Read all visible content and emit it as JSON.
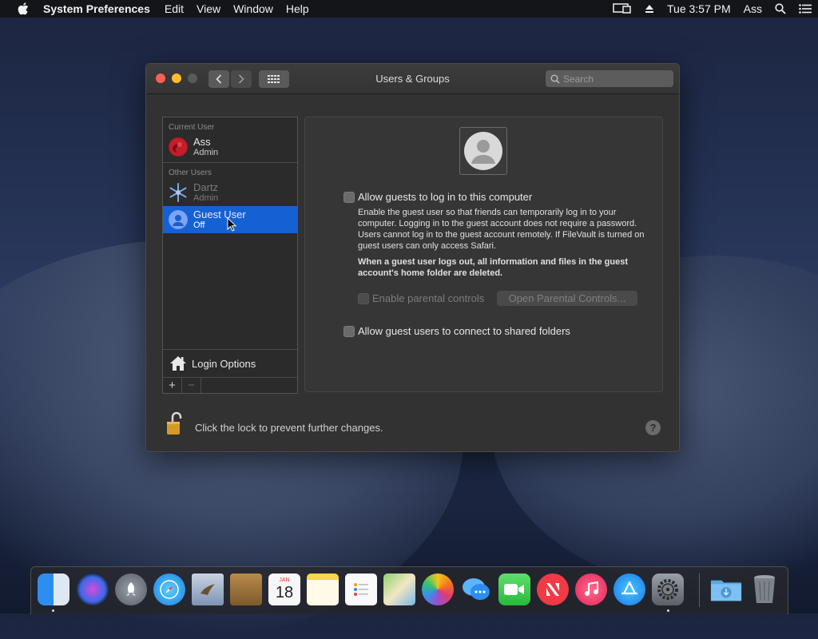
{
  "menubar": {
    "app_name": "System Preferences",
    "menus": [
      "Edit",
      "View",
      "Window",
      "Help"
    ],
    "clock": "Tue 3:57 PM",
    "user": "Ass"
  },
  "window": {
    "title": "Users & Groups",
    "search_placeholder": "Search"
  },
  "sidebar": {
    "current_user_header": "Current User",
    "current_user": {
      "name": "Ass",
      "role": "Admin"
    },
    "other_users_header": "Other Users",
    "other_users": [
      {
        "name": "Dartz",
        "role": "Admin"
      },
      {
        "name": "Guest User",
        "role": "Off"
      }
    ],
    "login_options": "Login Options",
    "add": "+",
    "remove": "−"
  },
  "panel": {
    "allow_guests_label": "Allow guests to log in to this computer",
    "description": "Enable the guest user so that friends can temporarily log in to your computer. Logging in to the guest account does not require a password. Users cannot log in to the guest account remotely. If FileVault is turned on guest users can only access Safari.",
    "warning": "When a guest user logs out, all information and files in the guest account's home folder are deleted.",
    "parental_label": "Enable parental controls",
    "parental_button": "Open Parental Controls...",
    "shared_folders_label": "Allow guest users to connect to shared folders"
  },
  "footer": {
    "lock_text": "Click the lock to prevent further changes.",
    "help": "?"
  },
  "calendar": {
    "month": "JAN",
    "day": "18"
  },
  "colors": {
    "selection": "#1561d4",
    "close": "#fc5f57",
    "minimize": "#febc2e"
  }
}
